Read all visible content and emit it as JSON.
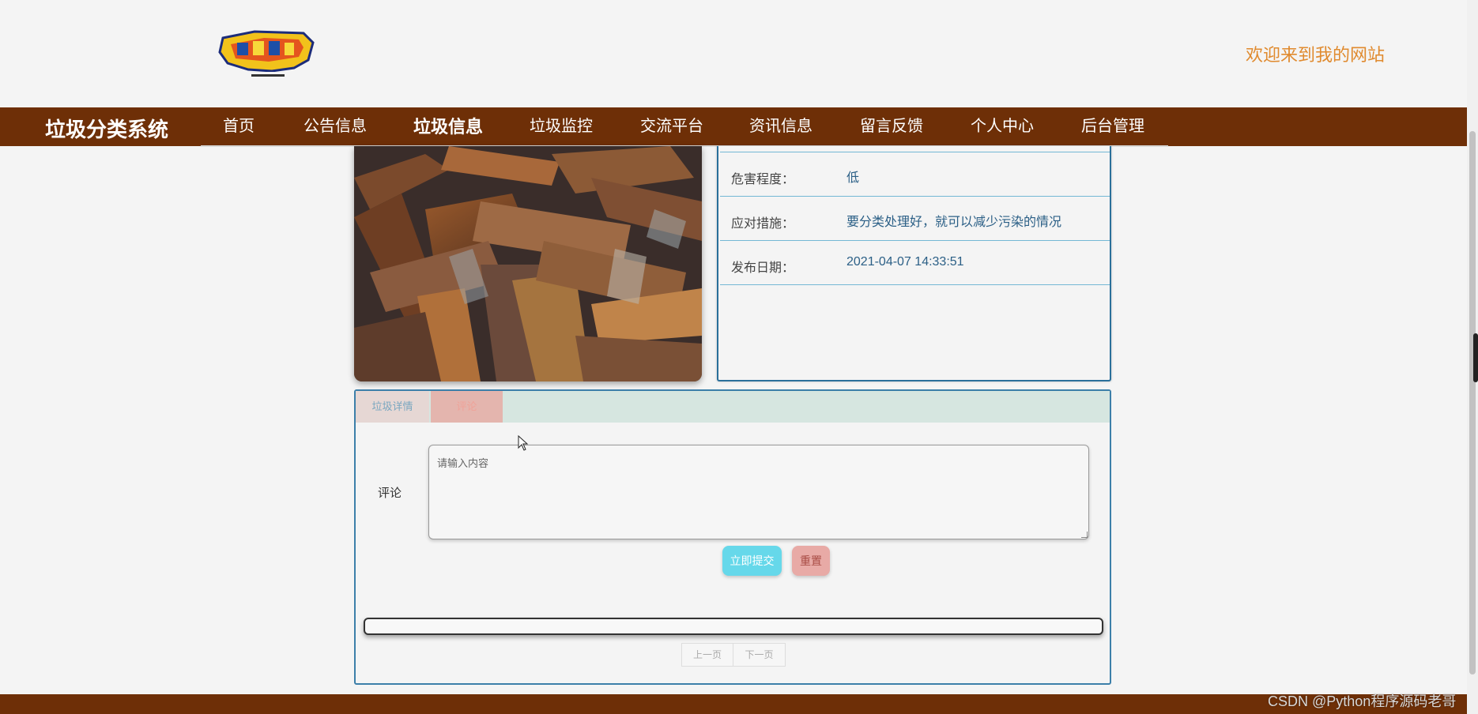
{
  "header": {
    "welcome_text": "欢迎来到我的网站",
    "logo_icon": "digimon-adventure-logo"
  },
  "nav": {
    "brand": "垃圾分类系统",
    "items": [
      {
        "label": "首页",
        "active": false
      },
      {
        "label": "公告信息",
        "active": false
      },
      {
        "label": "垃圾信息",
        "active": true
      },
      {
        "label": "垃圾监控",
        "active": false
      },
      {
        "label": "交流平台",
        "active": false
      },
      {
        "label": "资讯信息",
        "active": false
      },
      {
        "label": "留言反馈",
        "active": false
      },
      {
        "label": "个人中心",
        "active": false
      },
      {
        "label": "后台管理",
        "active": false
      }
    ]
  },
  "details": {
    "rows": [
      {
        "label": "危害程度：",
        "value": "低"
      },
      {
        "label": "应对措施：",
        "value": "要分类处理好，就可以减少污染的情况"
      },
      {
        "label": "发布日期：",
        "value": "2021-04-07 14:33:51"
      }
    ]
  },
  "tabs": [
    {
      "label": "垃圾详情"
    },
    {
      "label": "评论"
    }
  ],
  "comment": {
    "label": "评论",
    "placeholder": "请输入内容",
    "submit_label": "立即提交",
    "reset_label": "重置"
  },
  "pager": {
    "prev_label": "上一页",
    "next_label": "下一页"
  },
  "footer": {
    "watermark": "CSDN @Python程序源码老哥"
  },
  "colors": {
    "nav_bg": "#6e2f07",
    "accent_orange": "#e08a2e",
    "panel_border": "#2a6f9a",
    "submit_bg": "#66d8ea",
    "reset_bg": "#e8aaa6"
  }
}
